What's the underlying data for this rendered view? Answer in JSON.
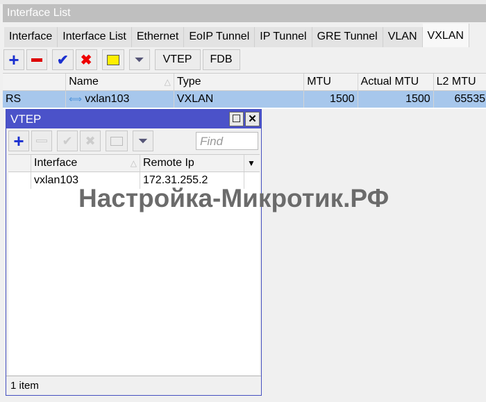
{
  "window": {
    "title": "Interface List"
  },
  "tabs": [
    "Interface",
    "Interface List",
    "Ethernet",
    "EoIP Tunnel",
    "IP Tunnel",
    "GRE Tunnel",
    "VLAN",
    "VXLAN"
  ],
  "toolbar": {
    "vtep": "VTEP",
    "fdb": "FDB"
  },
  "table": {
    "columns": [
      "",
      "Name",
      "Type",
      "MTU",
      "Actual MTU",
      "L2 MTU"
    ],
    "rows": [
      {
        "flag": "RS",
        "name": "vxlan103",
        "type": "VXLAN",
        "mtu": "1500",
        "actual_mtu": "1500",
        "l2_mtu": "65535"
      }
    ]
  },
  "vtep": {
    "title": "VTEP",
    "find_placeholder": "Find",
    "columns": [
      "Interface",
      "Remote Ip"
    ],
    "rows": [
      {
        "interface": "vxlan103",
        "remote_ip": "172.31.255.2"
      }
    ],
    "status": "1 item"
  },
  "watermark": "Настройка-Микротик.РФ",
  "colors": {
    "selection": "#a7c7ec",
    "vtep_title": "#4b52c9"
  }
}
